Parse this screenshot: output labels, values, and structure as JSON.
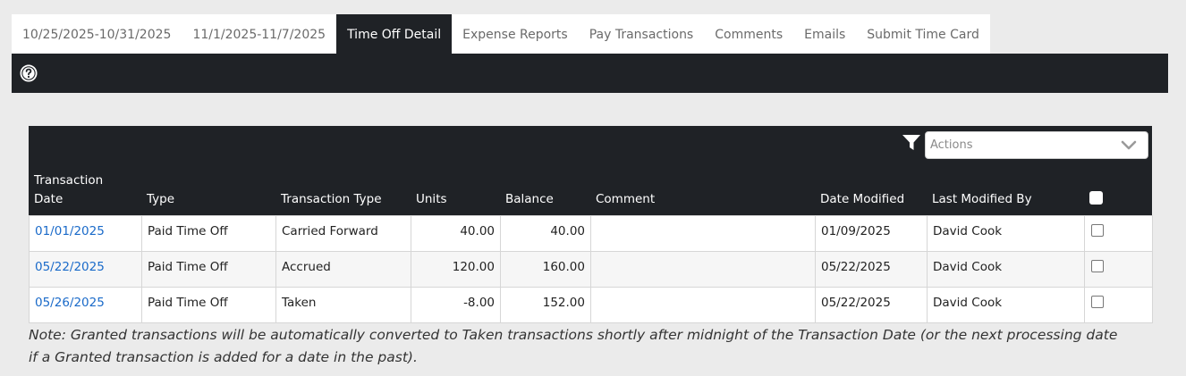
{
  "tabs": [
    {
      "label": "10/25/2025-10/31/2025",
      "active": false
    },
    {
      "label": "11/1/2025-11/7/2025",
      "active": false
    },
    {
      "label": "Time Off Detail",
      "active": true
    },
    {
      "label": "Expense Reports",
      "active": false
    },
    {
      "label": "Pay Transactions",
      "active": false
    },
    {
      "label": "Comments",
      "active": false
    },
    {
      "label": "Emails",
      "active": false
    },
    {
      "label": "Submit Time Card",
      "active": false
    }
  ],
  "toolbar": {
    "help_icon": "question-circle-icon"
  },
  "grid": {
    "filter_icon": "filter-icon",
    "actions_placeholder": "Actions",
    "columns": {
      "transaction_date": "Transaction Date",
      "type": "Type",
      "transaction_type": "Transaction Type",
      "units": "Units",
      "balance": "Balance",
      "comment": "Comment",
      "date_modified": "Date Modified",
      "last_modified_by": "Last Modified By"
    },
    "rows": [
      {
        "transaction_date": "01/01/2025",
        "type": "Paid Time Off",
        "transaction_type": "Carried Forward",
        "units": "40.00",
        "balance": "40.00",
        "comment": "",
        "date_modified": "01/09/2025",
        "last_modified_by": "David Cook",
        "checked": false
      },
      {
        "transaction_date": "05/22/2025",
        "type": "Paid Time Off",
        "transaction_type": "Accrued",
        "units": "120.00",
        "balance": "160.00",
        "comment": "",
        "date_modified": "05/22/2025",
        "last_modified_by": "David Cook",
        "checked": false
      },
      {
        "transaction_date": "05/26/2025",
        "type": "Paid Time Off",
        "transaction_type": "Taken",
        "units": "-8.00",
        "balance": "152.00",
        "comment": "",
        "date_modified": "05/22/2025",
        "last_modified_by": "David Cook",
        "checked": false
      }
    ]
  },
  "note": "Note: Granted transactions will be automatically converted to Taken transactions shortly after midnight of the Transaction Date (or the next processing date if a Granted transaction is added for a date in the past).",
  "colors": {
    "header_bg": "#1f2226",
    "link": "#1a6ac9",
    "page_bg": "#ebebeb"
  }
}
